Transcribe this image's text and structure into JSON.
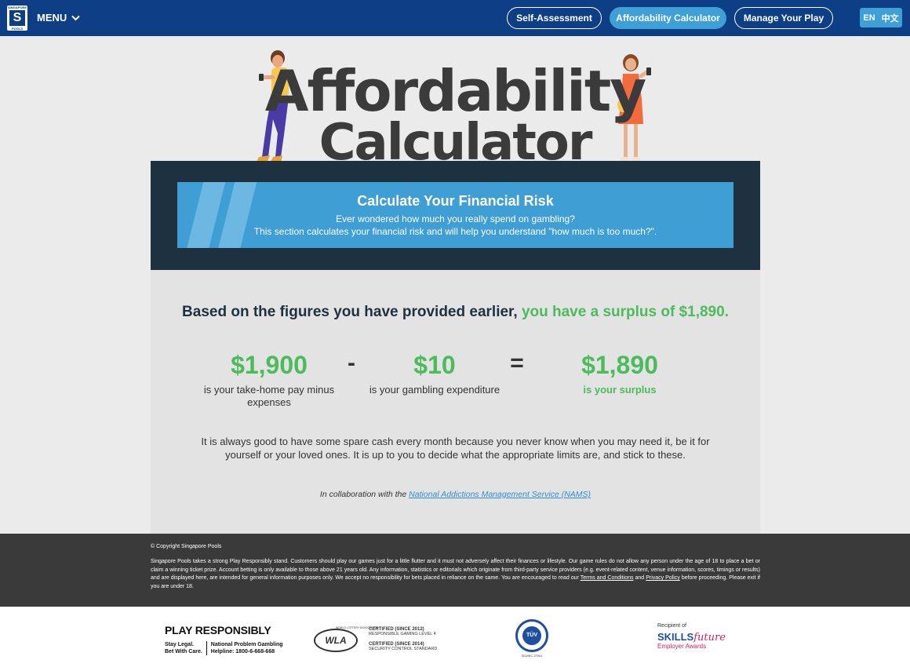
{
  "header": {
    "logo_top": "SINGAPORE",
    "logo_letter": "S",
    "logo_bottom": "POOLS",
    "menu_label": "MENU",
    "nav": [
      "Self-Assessment",
      "Affordability Calculator",
      "Manage Your Play"
    ],
    "lang_en": "EN",
    "lang_zh": "中文"
  },
  "hero": {
    "title_line1": "Affordability",
    "title_line2": "Calculator"
  },
  "banner": {
    "title": "Calculate Your Financial Risk",
    "line1": "Ever wondered how much you really spend on gambling?",
    "line2": "This section calculates your financial risk and will help you understand \"how much is too much?\"."
  },
  "result": {
    "summary_prefix": "Based on the figures you have provided earlier,",
    "summary_highlight": "you have a surplus of $1,890.",
    "income_amount": "$1,900",
    "income_desc": "is your take-home pay minus expenses",
    "minus": "-",
    "gambling_amount": "$10",
    "gambling_desc": "is your gambling expenditure",
    "equals": "=",
    "surplus_amount": "$1,890",
    "surplus_desc": "is your surplus",
    "advice": "It is always good to have some spare cash every month because you never know when you may need it, be it for yourself or your loved ones. It is up to you to decide what the appropriate limits are, and stick to these.",
    "collab_prefix": "In collaboration with the",
    "collab_link": "National Addictions Management Service (NAMS)"
  },
  "footer": {
    "copyright": "© Copyright Singapore Pools",
    "disclaimer": "Singapore Pools takes a strong Play Responsibly stand. Customers should play our games just for a little flutter and it must not adversely affect their finances or lifestyle. Our game rules do not allow any person under the age of 18 to place a bet or claim a winning ticket prize. Account betting is only available to those above 21 years old. Any information, statistics or editorials which originate from third-party service providers (e.g. event-related content, venue information, scores, timings or results) and are displayed here, are intended for general information purposes only. We accept no responsibility for bets placed in reliance on the same. You are encouraged to read our",
    "terms_link": "Terms and Conditions",
    "and_text": "and",
    "privacy_link": "Privacy Policy",
    "disclaimer_end": "before proceeding. Please exit if you are under 18."
  },
  "bottom": {
    "pr_title": "PLAY RESPONSIBLY",
    "pr_left1": "Stay Legal.",
    "pr_left2": "Bet With Care.",
    "pr_right1": "National Problem Gambling",
    "pr_right2": "Helpline: 1800-6-668-668",
    "wla_logo": "WLA",
    "wla_top": "WORLD LOTTERY ASSOCIATION",
    "wla_c1": "CERTIFIED (SINCE 2012)",
    "wla_c1b": "RESPONSIBLE GAMING LEVEL 4",
    "wla_c2": "CERTIFIED (SINCE 2014)",
    "wla_c2b": "SECURITY CONTROL STANDARD",
    "tuv_label": "TÜV",
    "tuv_caption": "ISO/IEC 27001",
    "sf_recipient": "Recipient of",
    "sf_skills": "SKILLS",
    "sf_future": "future",
    "sf_awards": "Employer Awards"
  },
  "colors": {
    "header_bg": "#0e3f86",
    "active_nav": "#3f9fd7",
    "dark_block": "#1d3140",
    "banner": "#3f9ed4",
    "accent_green": "#4cbb5b",
    "footer_bg": "#3a3a3a"
  }
}
